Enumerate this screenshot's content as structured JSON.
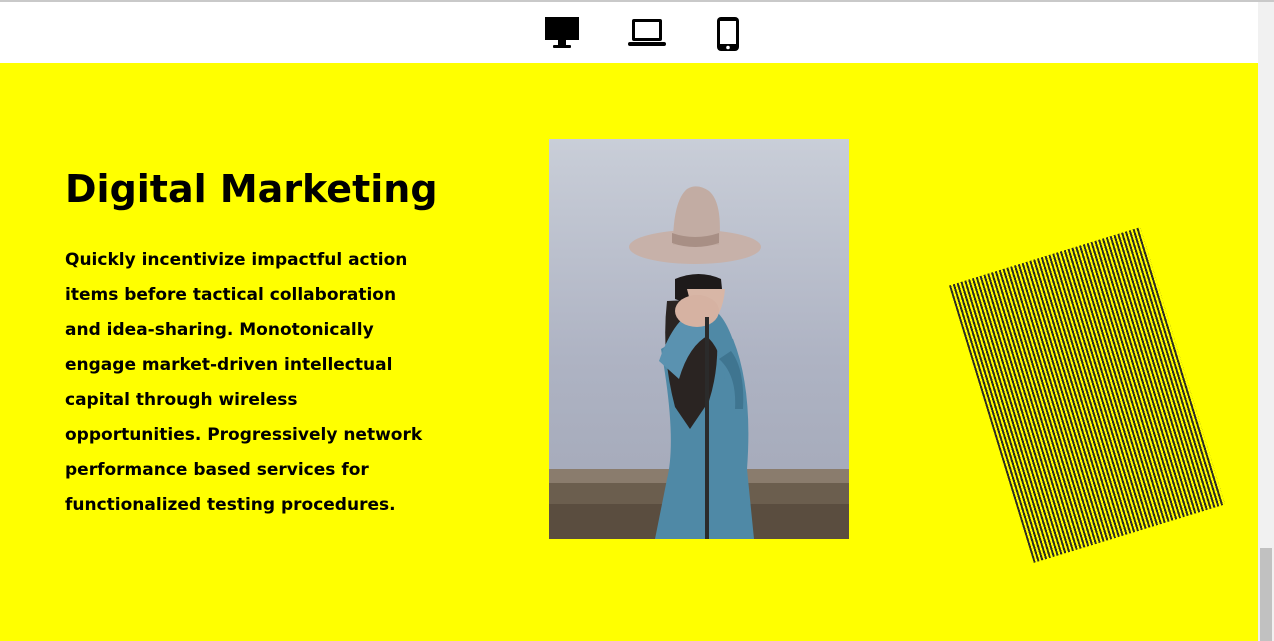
{
  "toolbar": {
    "devices": [
      {
        "icon": "desktop-icon"
      },
      {
        "icon": "laptop-icon"
      },
      {
        "icon": "mobile-icon"
      }
    ]
  },
  "hero": {
    "background_color": "#ffff00",
    "title": "Digital Marketing",
    "body": "Quickly incentivize impactful action items before tactical collaboration and idea-sharing. Monotonically engage market-driven intellectual capital through wireless opportunities. Progressively network performance based services for functionalized testing procedures."
  },
  "colors": {
    "text": "#000000",
    "stripe_dark": "#2e2d24"
  }
}
